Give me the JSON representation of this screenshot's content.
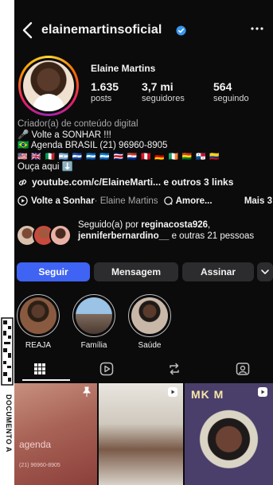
{
  "header": {
    "username": "elainemartinsoficial",
    "back_icon": "chevron-left-icon",
    "verified_icon": "verified-badge-icon",
    "more_icon": "ellipsis-icon"
  },
  "profile": {
    "name": "Elaine Martins",
    "stats": [
      {
        "value": "1.635",
        "label": "posts"
      },
      {
        "value": "3,7 mi",
        "label": "seguidores"
      },
      {
        "value": "564",
        "label": "seguindo"
      }
    ]
  },
  "bio": {
    "category": "Criador(a) de conteúdo digital",
    "line1": "🎤 Volte a SONHAR !!!",
    "line2": "🇧🇷 Agenda BRASIL (21) 96960-8905",
    "flags": "🇺🇸 🇬🇧 🇮🇹 🇦🇷 🇸🇻 🇳🇮 🇭🇳 🇨🇷 🇵🇾 🇵🇪 🇩🇪 🇮🇪 🇧🇴 🇵🇦 🇨🇴",
    "ouca": "Ouça aqui ⬇️"
  },
  "link": {
    "text": "youtube.com/c/ElaineMarti...",
    "extra": " e outros 3 links"
  },
  "chips": {
    "item1": "Volte a Sonhar",
    "item1_sub": " · Elaine Martins",
    "item2": "Amore...",
    "more": "Mais 3"
  },
  "followed_by": {
    "prefix": "Seguido(a) por ",
    "user1": "reginacosta926",
    "sep": ", ",
    "user2": "jenniferbernardino__",
    "suffix": " e outras 21 pessoas"
  },
  "actions": {
    "follow": "Seguir",
    "message": "Mensagem",
    "subscribe": "Assinar",
    "dropdown_icon": "chevron-down-icon"
  },
  "highlights": [
    {
      "label": "REAJA"
    },
    {
      "label": "Família"
    },
    {
      "label": "Saúde"
    }
  ],
  "tabs": [
    "grid-icon",
    "reels-icon",
    "reposts-icon",
    "tagged-icon"
  ],
  "grid": {
    "post1_text": "agenda",
    "post1_phone": "(21) 96960-8905",
    "post3_text": "MK M"
  },
  "watermark": {
    "text": "DOCUMENTO A"
  },
  "colors": {
    "background": "#0b0b0c",
    "primary_button": "#3f63f2",
    "secondary_button": "#2c2c2e",
    "verified": "#3897f0"
  }
}
